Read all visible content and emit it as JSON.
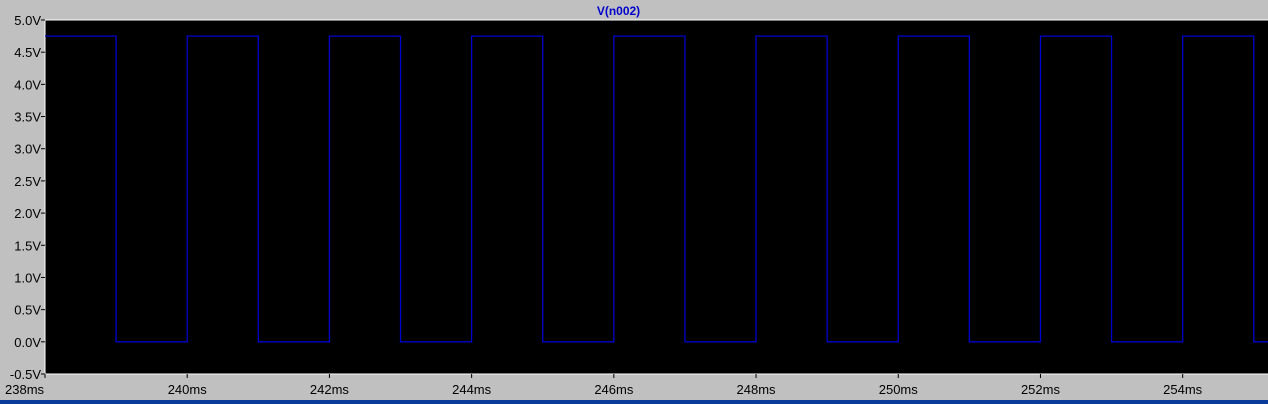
{
  "chart_data": {
    "type": "line",
    "title": "V(n002)",
    "xlabel": "",
    "ylabel": "",
    "xlim": [
      238,
      255.2
    ],
    "ylim": [
      -0.5,
      5.0
    ],
    "x_unit": "ms",
    "y_unit": "V",
    "grid": false,
    "x_ticks": [
      "238ms",
      "240ms",
      "242ms",
      "244ms",
      "246ms",
      "248ms",
      "250ms",
      "252ms",
      "254ms"
    ],
    "y_ticks": [
      "5.0V",
      "4.5V",
      "4.0V",
      "3.5V",
      "3.0V",
      "2.5V",
      "2.0V",
      "1.5V",
      "1.0V",
      "0.5V",
      "0.0V",
      "-0.5V"
    ],
    "series": [
      {
        "name": "V(n002)",
        "color": "#0000cc",
        "x": [
          238,
          239,
          239,
          240,
          240,
          241,
          241,
          242,
          242,
          243,
          243,
          244,
          244,
          245,
          245,
          246,
          246,
          247,
          247,
          248,
          248,
          249,
          249,
          250,
          250,
          251,
          251,
          252,
          252,
          253,
          253,
          254,
          254,
          255,
          255,
          255.2
        ],
        "y": [
          4.75,
          4.75,
          0,
          0,
          4.75,
          4.75,
          0,
          0,
          4.75,
          4.75,
          0,
          0,
          4.75,
          4.75,
          0,
          0,
          4.75,
          4.75,
          0,
          0,
          4.75,
          4.75,
          0,
          0,
          4.75,
          4.75,
          0,
          0,
          4.75,
          4.75,
          0,
          0,
          4.75,
          4.75,
          0,
          0
        ]
      }
    ]
  },
  "colors": {
    "window_background": "#c0c0c0",
    "plot_background": "#000000",
    "frame": "#ffffff",
    "trace": "#0000cc",
    "tick_text": "#000000"
  }
}
